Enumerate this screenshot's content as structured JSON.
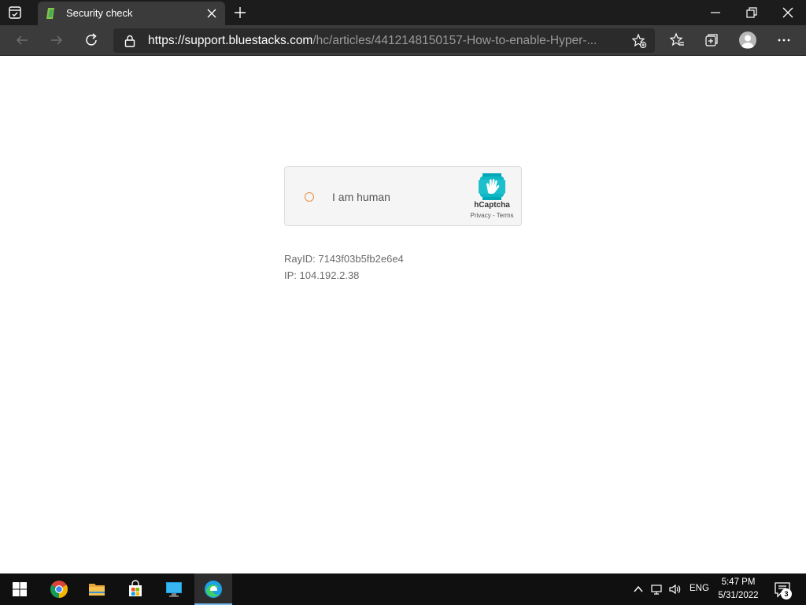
{
  "browser": {
    "tab": {
      "title": "Security check"
    },
    "address": {
      "url_domain": "https://support.bluestacks.com",
      "url_path": "/hc/articles/4412148150157-How-to-enable-Hyper-..."
    }
  },
  "page": {
    "captcha": {
      "checkbox_label": "I am human",
      "brand": "hCaptcha",
      "privacy": "Privacy",
      "separator": " - ",
      "terms": "Terms",
      "accent_color": "#ee8c3c"
    },
    "ray_id": "RayID: 7143f03b5fb2e6e4",
    "ip": "IP: 104.192.2.38"
  },
  "taskbar": {
    "language": "ENG",
    "time": "5:47 PM",
    "date": "5/31/2022",
    "notification_count": "3",
    "apps": [
      "windows-start-icon",
      "chrome-icon",
      "file-explorer-icon",
      "store-icon",
      "desktop-icon",
      "edge-icon"
    ]
  }
}
